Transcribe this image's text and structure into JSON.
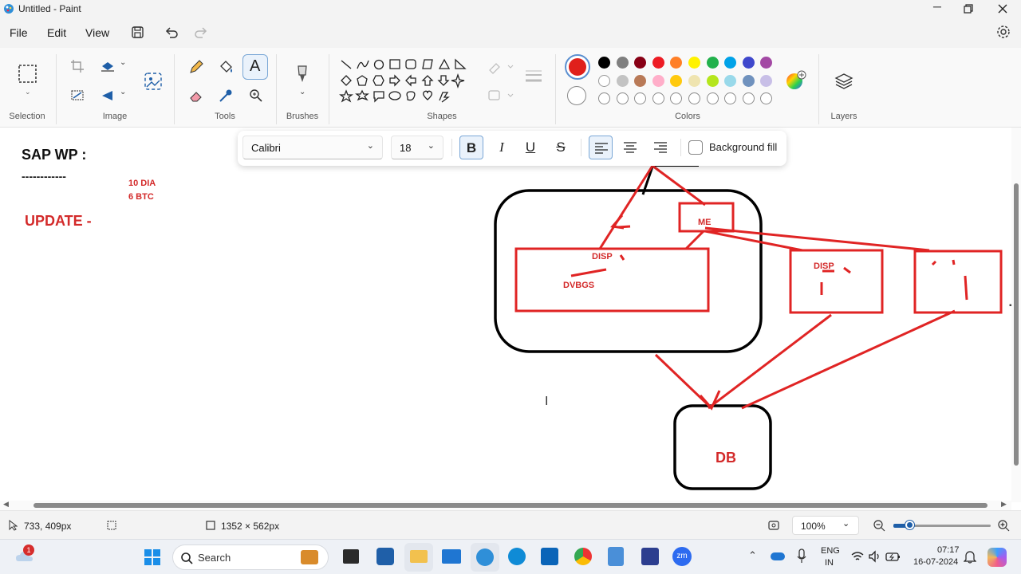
{
  "window": {
    "title": "Untitled - Paint"
  },
  "menu": {
    "file": "File",
    "edit": "Edit",
    "view": "View"
  },
  "ribbon": {
    "groups": {
      "selection": "Selection",
      "image": "Image",
      "tools": "Tools",
      "brushes": "Brushes",
      "shapes": "Shapes",
      "colors": "Colors",
      "layers": "Layers"
    },
    "palette": {
      "primary": "#e0201b",
      "secondary": "#ffffff",
      "row1": [
        "#000000",
        "#7f7f7f",
        "#880015",
        "#ed1c24",
        "#ff7f27",
        "#fff200",
        "#22b14c",
        "#00a2e8",
        "#3f48cc",
        "#a349a4"
      ],
      "row2": [
        "#ffffff",
        "#c3c3c3",
        "#b97a57",
        "#ffaec9",
        "#ffc90e",
        "#efe4b0",
        "#b5e61d",
        "#99d9ea",
        "#7092be",
        "#c8bfe7"
      ],
      "row3": [
        "",
        "",
        "",
        "",
        "",
        "",
        "",
        "",
        "",
        ""
      ]
    }
  },
  "textbar": {
    "font": "Calibri",
    "size": "18",
    "bold": "B",
    "italic": "I",
    "underline": "U",
    "strike": "S",
    "background_fill": "Background fill"
  },
  "canvas": {
    "title": "SAP WP :",
    "underline": "------------",
    "dia": "10 DIA",
    "btc": "6 BTC",
    "update": "UPDATE -",
    "me": "ME",
    "disp1": "DISP",
    "dvbgs": "DVBGS",
    "disp2": "DISP",
    "db": "DB",
    "ink_color": "#e02424"
  },
  "status": {
    "cursor": "733, 409px",
    "canvas_size": "1352 × 562px",
    "zoom": "100%"
  },
  "taskbar": {
    "search": "Search",
    "lang1": "ENG",
    "lang2": "IN",
    "time": "07:17",
    "date": "16-07-2024",
    "weather_badge": "1"
  }
}
